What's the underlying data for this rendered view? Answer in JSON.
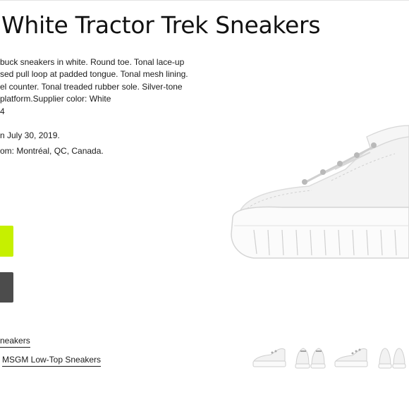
{
  "product": {
    "title": "White Tractor Trek Sneakers",
    "description_lines": [
      "buck sneakers in white. Round toe. Tonal lace-up",
      "sed pull loop at padded tongue. Tonal mesh lining.",
      "el counter. Tonal treaded rubber sole. Silver-tone",
      "platform.Supplier color: White",
      "4"
    ],
    "date_text": "n July 30, 2019.",
    "origin_text": "om: Montréal, QC, Canada."
  },
  "links": {
    "first": "neakers",
    "second": "MSGM Low-Top Sneakers"
  },
  "colors": {
    "lime_button": "#c6f000",
    "dark_button": "#4c4c4c"
  }
}
